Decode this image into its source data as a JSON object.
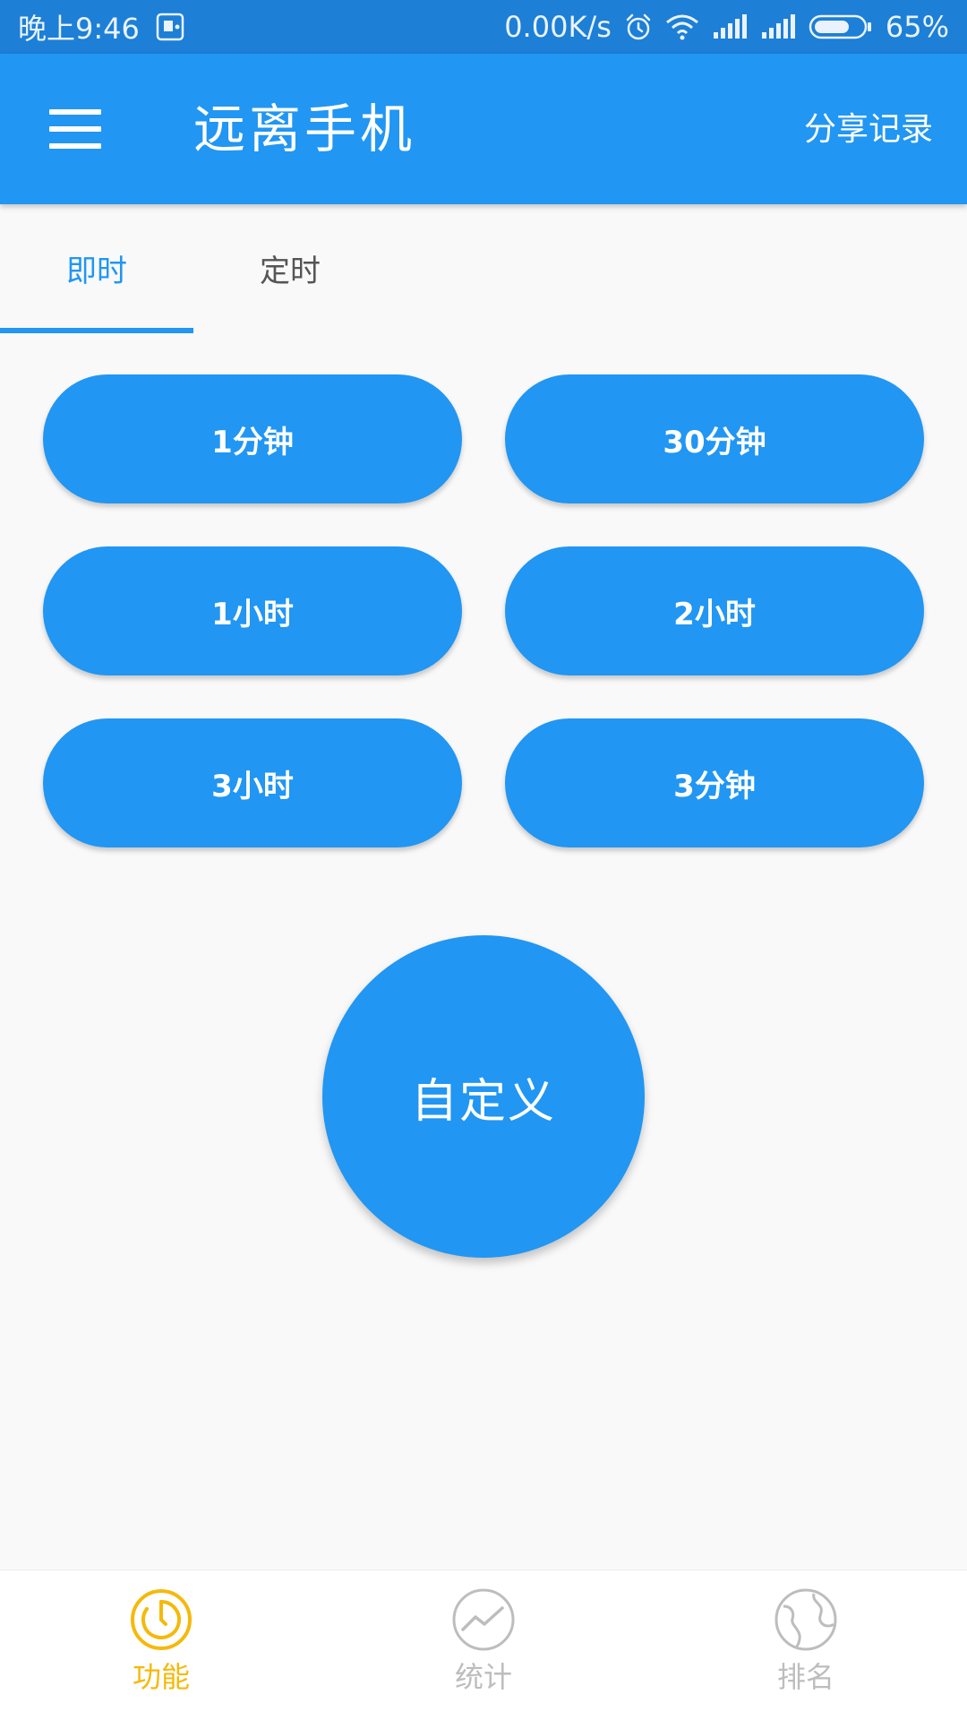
{
  "status_bar": {
    "time": "晚上9:46",
    "speed": "0.00K/s",
    "battery": "65%",
    "icons": [
      "notification-icon",
      "alarm-icon",
      "wifi-icon",
      "signal-icon",
      "signal-icon",
      "battery-icon"
    ]
  },
  "app_bar": {
    "title": "远离手机",
    "share_records": "分享记录",
    "menu_icon": "hamburger-menu-icon"
  },
  "tabs": [
    {
      "label": "即时",
      "selected": true
    },
    {
      "label": "定时",
      "selected": false
    }
  ],
  "presets": [
    {
      "label": "1分钟"
    },
    {
      "label": "30分钟"
    },
    {
      "label": "1小时"
    },
    {
      "label": "2小时"
    },
    {
      "label": "3小时"
    },
    {
      "label": "3分钟"
    }
  ],
  "custom_button": {
    "label": "自定义"
  },
  "bottom_nav": [
    {
      "label": "功能",
      "icon": "timer-icon",
      "active": true
    },
    {
      "label": "统计",
      "icon": "trend-chart-icon",
      "active": false
    },
    {
      "label": "排名",
      "icon": "globe-icon",
      "active": false
    }
  ],
  "colors": {
    "primary": "#2196f3",
    "status_bar": "#1d7fd6",
    "active_nav": "#f5b90a",
    "inactive_nav": "#bdbdbd"
  }
}
